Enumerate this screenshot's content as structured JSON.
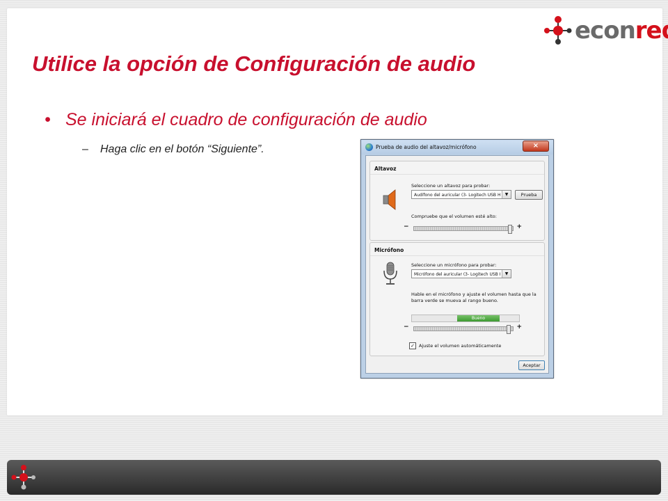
{
  "brand": {
    "logo_part1": "econ",
    "logo_part2": "red",
    "colors": {
      "red": "#c8102e",
      "logo_red": "#d4111b",
      "logo_gray": "#6a6a6a"
    }
  },
  "slide": {
    "title": "Utilice la opción de Configuración de audio",
    "bullet": "Se iniciará el cuadro de configuración de audio",
    "subbullet": "Haga clic en el botón “Siguiente”."
  },
  "dialog": {
    "title": "Prueba de audio del altavoz/micrófono",
    "close_label": "×",
    "app_icon": "windows-orb-icon",
    "speaker_group": {
      "title": "Altavoz",
      "icon": "speaker-icon",
      "select_label": "Seleccione un altavoz para probar:",
      "selected_device": "Audífono del auricular (3- Logitech USB H",
      "test_button": "Prueba",
      "volume_label": "Compruebe que el volumen esté alto:",
      "minus": "−",
      "plus": "+",
      "volume_level": 0.97
    },
    "mic_group": {
      "title": "Micrófono",
      "icon": "microphone-icon",
      "select_label": "Seleccione un micrófono para probar:",
      "selected_device": "Micrófono del auricular (3- Logitech USB H",
      "help_text": "Hable en el micrófono y ajuste el volumen hasta que la barra verde se mueva al rango bueno.",
      "meter_label": "Bueno",
      "meter_range": [
        0.42,
        0.82
      ],
      "minus": "−",
      "plus": "+",
      "volume_level": 0.96,
      "auto_adjust_label": "Ajuste el volumen automáticamente",
      "auto_adjust_checked": true,
      "checkmark": "✓"
    },
    "ok_button": "Aceptar"
  }
}
